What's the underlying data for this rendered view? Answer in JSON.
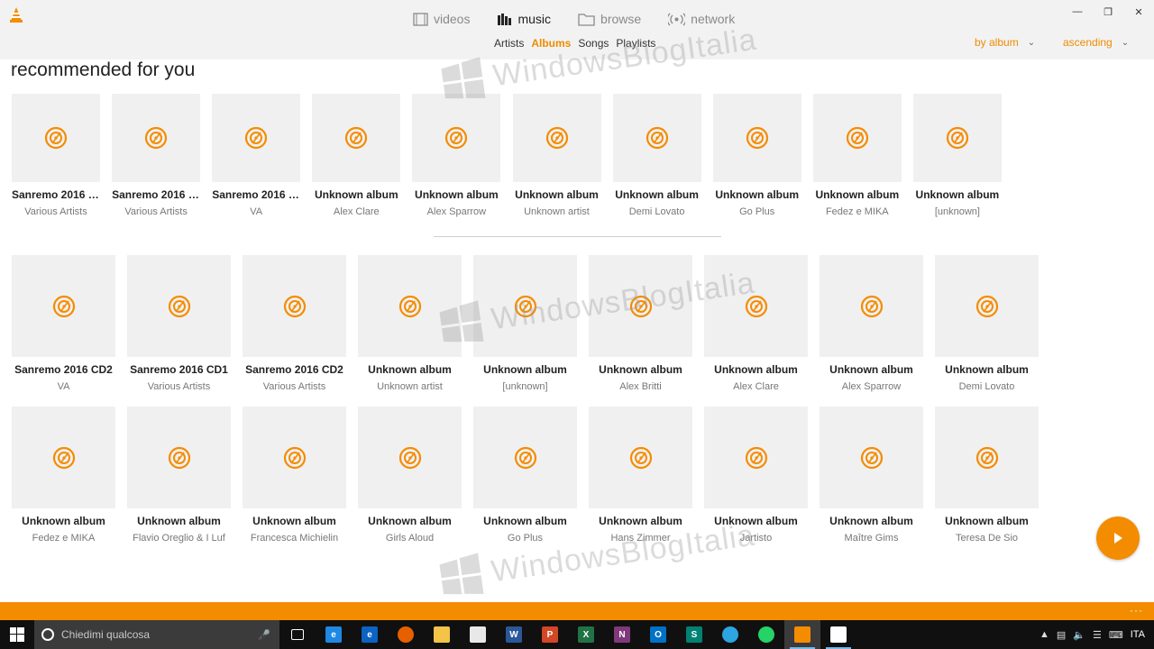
{
  "nav": {
    "tabs": [
      {
        "label": "videos",
        "icon": "film-icon"
      },
      {
        "label": "music",
        "icon": "music-bars-icon"
      },
      {
        "label": "browse",
        "icon": "folder-icon"
      },
      {
        "label": "network",
        "icon": "network-icon"
      }
    ],
    "active_tab": "music",
    "sub_tabs": [
      "Artists",
      "Albums",
      "Songs",
      "Playlists"
    ],
    "active_sub_tab": "Albums"
  },
  "sort": {
    "by": "by album",
    "order": "ascending"
  },
  "section_title": "recommended for you",
  "colors": {
    "accent": "#f48c00",
    "tile_bg": "#f0f0f0",
    "taskbar": "#101010"
  },
  "recommended": [
    {
      "title": "Sanremo 2016 C...",
      "artist": "Various Artists"
    },
    {
      "title": "Sanremo 2016 C...",
      "artist": "Various Artists"
    },
    {
      "title": "Sanremo 2016 C...",
      "artist": "VA"
    },
    {
      "title": "Unknown album",
      "artist": "Alex Clare"
    },
    {
      "title": "Unknown album",
      "artist": "Alex Sparrow"
    },
    {
      "title": "Unknown album",
      "artist": "Unknown artist"
    },
    {
      "title": "Unknown album",
      "artist": "Demi Lovato"
    },
    {
      "title": "Unknown album",
      "artist": "Go Plus"
    },
    {
      "title": "Unknown album",
      "artist": "Fedez e MIKA"
    },
    {
      "title": "Unknown album",
      "artist": "[unknown]"
    }
  ],
  "albums": [
    {
      "title": "Sanremo 2016 CD2",
      "artist": "VA"
    },
    {
      "title": "Sanremo 2016 CD1",
      "artist": "Various Artists"
    },
    {
      "title": "Sanremo 2016 CD2",
      "artist": "Various Artists"
    },
    {
      "title": "Unknown album",
      "artist": "Unknown artist"
    },
    {
      "title": "Unknown album",
      "artist": "[unknown]"
    },
    {
      "title": "Unknown album",
      "artist": "Alex Britti"
    },
    {
      "title": "Unknown album",
      "artist": "Alex Clare"
    },
    {
      "title": "Unknown album",
      "artist": "Alex Sparrow"
    },
    {
      "title": "Unknown album",
      "artist": "Demi Lovato"
    },
    {
      "title": "Unknown album",
      "artist": "Fedez e MIKA"
    },
    {
      "title": "Unknown album",
      "artist": "Flavio Oreglio & I Luf"
    },
    {
      "title": "Unknown album",
      "artist": "Francesca Michielin"
    },
    {
      "title": "Unknown album",
      "artist": "Girls Aloud"
    },
    {
      "title": "Unknown album",
      "artist": "Go Plus"
    },
    {
      "title": "Unknown album",
      "artist": "Hans Zimmer"
    },
    {
      "title": "Unknown album",
      "artist": "Jartisto"
    },
    {
      "title": "Unknown album",
      "artist": "Maître Gims"
    },
    {
      "title": "Unknown album",
      "artist": "Teresa De Sio"
    }
  ],
  "watermark": "WindowsBlogItalia",
  "taskbar": {
    "search_placeholder": "Chiedimi qualcosa",
    "language": "ITA",
    "apps": [
      {
        "icon": "task-view-icon",
        "letter": "",
        "color": "#101010"
      },
      {
        "icon": "internet-explorer-icon",
        "letter": "e",
        "color": "#1e88e5"
      },
      {
        "icon": "edge-icon",
        "letter": "e",
        "color": "#0b63c4"
      },
      {
        "icon": "firefox-icon",
        "letter": "",
        "color": "#e66000"
      },
      {
        "icon": "file-explorer-icon",
        "letter": "",
        "color": "#f3c447"
      },
      {
        "icon": "store-icon",
        "letter": "",
        "color": "#e8e8e8"
      },
      {
        "icon": "word-icon",
        "letter": "W",
        "color": "#2b579a"
      },
      {
        "icon": "powerpoint-icon",
        "letter": "P",
        "color": "#d24726"
      },
      {
        "icon": "excel-icon",
        "letter": "X",
        "color": "#217346"
      },
      {
        "icon": "onenote-icon",
        "letter": "N",
        "color": "#80397b"
      },
      {
        "icon": "outlook-icon",
        "letter": "O",
        "color": "#0072c6"
      },
      {
        "icon": "sway-icon",
        "letter": "S",
        "color": "#008272"
      },
      {
        "icon": "telegram-icon",
        "letter": "",
        "color": "#2ca5e0"
      },
      {
        "icon": "whatsapp-icon",
        "letter": "",
        "color": "#25d366"
      },
      {
        "icon": "vlc-icon",
        "letter": "",
        "color": "#f48c00"
      },
      {
        "icon": "app-window-icon",
        "letter": "",
        "color": "#ffffff"
      }
    ]
  }
}
